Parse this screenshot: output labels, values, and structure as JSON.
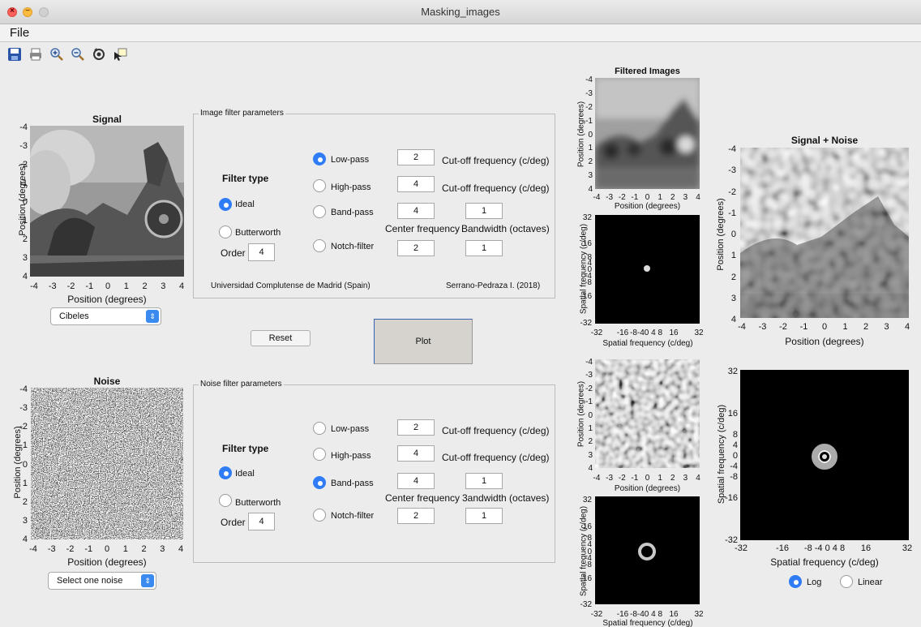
{
  "window": {
    "title": "Masking_images",
    "menu_file": "File"
  },
  "toolbar": {
    "icons": [
      "save-icon",
      "print-icon",
      "zoom-in-icon",
      "zoom-out-icon",
      "rotate-icon",
      "data-cursor-icon"
    ]
  },
  "signal": {
    "title": "Signal",
    "xlabel": "Position (degrees)",
    "ylabel": "Position (degrees)",
    "ticks": [
      "-4",
      "-3",
      "-2",
      "-1",
      "0",
      "1",
      "2",
      "3",
      "4"
    ],
    "image_select": "Cibeles"
  },
  "noise": {
    "title": "Noise",
    "xlabel": "Position (degrees)",
    "ylabel": "Position (degrees)",
    "ticks": [
      "-4",
      "-3",
      "-2",
      "-1",
      "0",
      "1",
      "2",
      "3",
      "4"
    ],
    "noise_select": "Select one noise"
  },
  "image_filter": {
    "title": "Image filter parameters",
    "filter_type_label": "Filter type",
    "ideal": "Ideal",
    "butterworth": "Butterworth",
    "order_label": "Order",
    "order": "4",
    "low_pass": "Low-pass",
    "high_pass": "High-pass",
    "band_pass": "Band-pass",
    "notch": "Notch-filter",
    "low_cutoff": "2",
    "high_cutoff": "4",
    "band_center": "4",
    "band_width": "1",
    "notch_center": "2",
    "notch_width": "1",
    "cutoff_label": "Cut-off frequency (c/deg)",
    "center_label": "Center frequency",
    "bandwidth_label": "Bandwidth (octaves)",
    "credit_left": "Universidad Complutense de Madrid (Spain)",
    "credit_right": "Serrano-Pedraza I. (2018)"
  },
  "noise_filter": {
    "title": "Noise filter parameters",
    "filter_type_label": "Filter type",
    "ideal": "Ideal",
    "butterworth": "Butterworth",
    "order_label": "Order",
    "order": "4",
    "low_pass": "Low-pass",
    "high_pass": "High-pass",
    "band_pass": "Band-pass",
    "notch": "Notch-filter",
    "low_cutoff": "2",
    "high_cutoff": "4",
    "band_center": "4",
    "band_width": "1",
    "notch_center": "2",
    "notch_width": "1",
    "cutoff_label": "Cut-off frequency (c/deg)",
    "center_label": "Center frequency",
    "bandwidth_label": "3andwidth (octaves)"
  },
  "buttons": {
    "reset": "Reset",
    "plot": "Plot"
  },
  "filtered": {
    "title": "Filtered Images",
    "pos_xlabel": "Position (degrees)",
    "pos_ylabel": "Position (degrees)",
    "freq_xlabel": "Spatial frequency (c/deg)",
    "freq_ylabel": "Spatial frequency (c/deg)",
    "pos_ticks": [
      "-4",
      "-3",
      "-2",
      "-1",
      "0",
      "1",
      "2",
      "3",
      "4"
    ],
    "freq_xticks": [
      "-32",
      "-16",
      "-8-40 4 8",
      "16",
      "32"
    ],
    "freq_yticks": [
      "32",
      "16",
      "8",
      "4",
      "0",
      "-4",
      "-8",
      "-16",
      "-32"
    ]
  },
  "combined": {
    "title": "Signal + Noise",
    "xlabel": "Position (degrees)",
    "ylabel": "Position (degrees)",
    "ticks": [
      "-4",
      "-3",
      "-2",
      "-1",
      "0",
      "1",
      "2",
      "3",
      "4"
    ],
    "freq_xlabel": "Spatial frequency (c/deg)",
    "freq_ylabel": "Spatial frequency (c/deg)",
    "freq_xticks": [
      "-32",
      "-16",
      "-8 -4 0 4 8",
      "16",
      "32"
    ],
    "freq_yticks": [
      "32",
      "16",
      "8",
      "4",
      "0",
      "-4",
      "-8",
      "-16",
      "-32"
    ],
    "scale_log": "Log",
    "scale_linear": "Linear"
  }
}
